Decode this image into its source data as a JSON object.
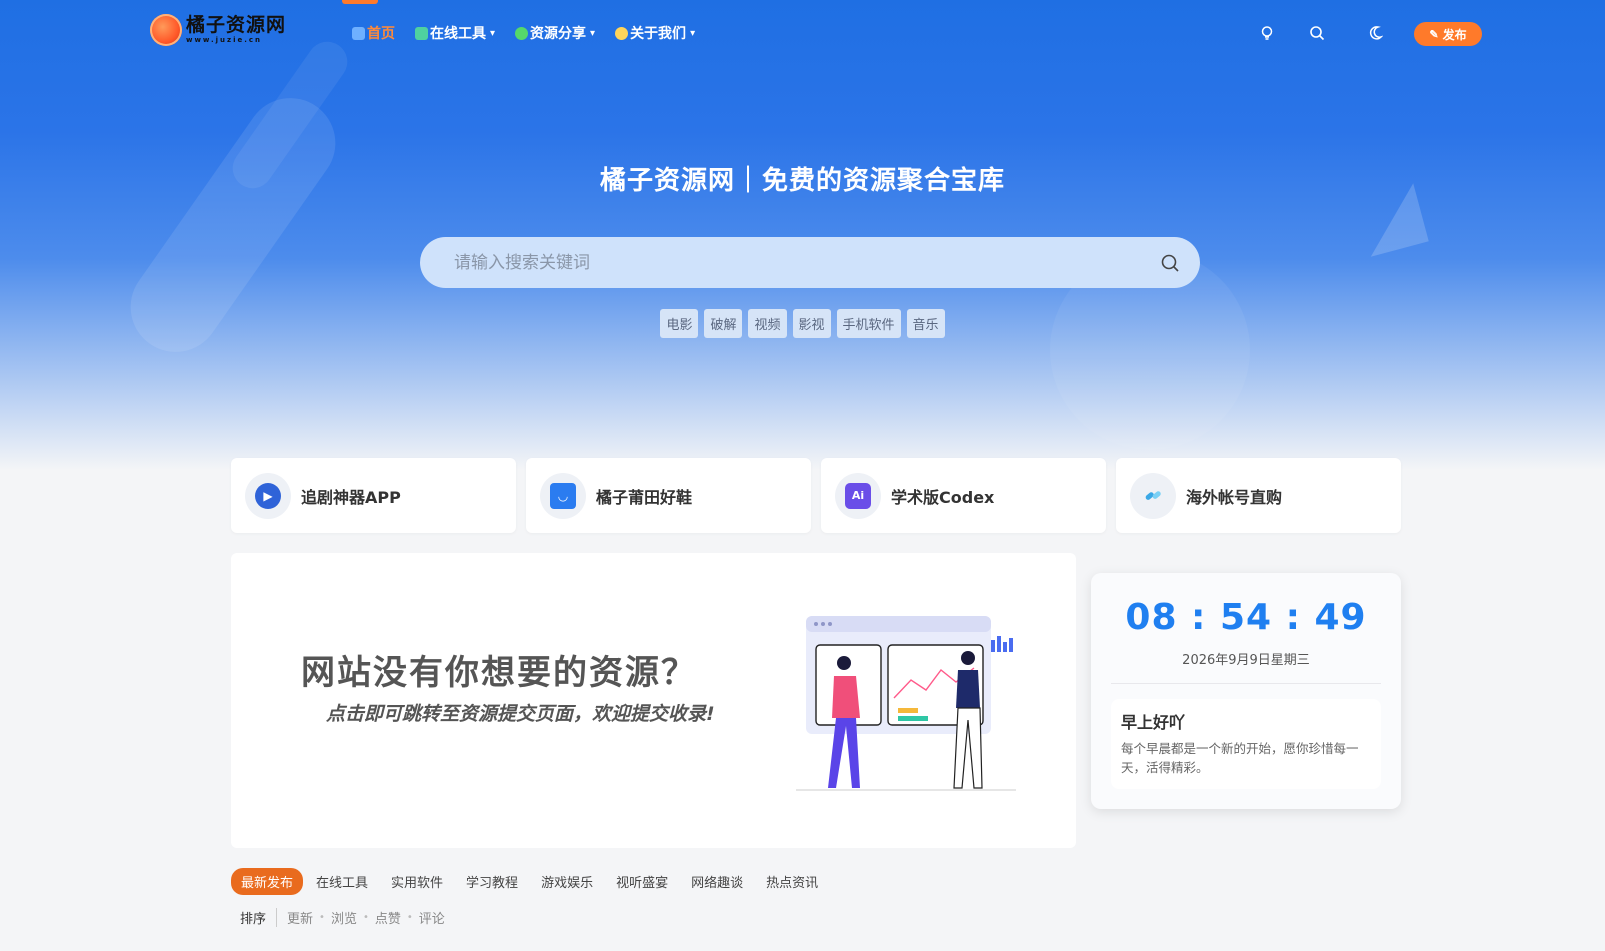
{
  "brand": {
    "name": "橘子资源网",
    "domain": "www.juzie.cn"
  },
  "nav": {
    "items": [
      {
        "label": "首页",
        "active": true
      },
      {
        "label": "在线工具",
        "dropdown": true
      },
      {
        "label": "资源分享",
        "dropdown": true
      },
      {
        "label": "关于我们",
        "dropdown": true
      }
    ],
    "icons": [
      "lightbulb-icon",
      "search-icon",
      "moon-icon"
    ],
    "publish_label": "发布"
  },
  "hero": {
    "title": "橘子资源网｜免费的资源聚合宝库",
    "search_placeholder": "请输入搜索关键词",
    "tags": [
      "电影",
      "破解",
      "视频",
      "影视",
      "手机软件",
      "音乐"
    ]
  },
  "cards": [
    {
      "label": "追剧神器APP",
      "icon": "play-icon",
      "color": "#2f63d8"
    },
    {
      "label": "橘子莆田好鞋",
      "icon": "shopping-bag-icon",
      "color": "#2b7cf0"
    },
    {
      "label": "学术版Codex",
      "icon": "ai-icon",
      "color": "#6a4ee8"
    },
    {
      "label": "海外帐号直购",
      "icon": "link-icon",
      "color": "#3aa8e6"
    }
  ],
  "banner": {
    "headline": "网站没有你想要的资源？",
    "subline": "点击即可跳转至资源提交页面，欢迎提交收录!"
  },
  "clock": {
    "time": "08 : 54 : 49",
    "date": "2026年9月9日星期三",
    "greeting_title": "早上好吖",
    "greeting_text": "每个早晨都是一个新的开始，愿你珍惜每一天，活得精彩。"
  },
  "tabs": [
    "最新发布",
    "在线工具",
    "实用软件",
    "学习教程",
    "游戏娱乐",
    "视听盛宴",
    "网络趣谈",
    "热点资讯"
  ],
  "sort": {
    "label": "排序",
    "options": [
      "更新",
      "浏览",
      "点赞",
      "评论"
    ]
  },
  "colors": {
    "accent": "#ff7a2a",
    "primary": "#1f6fe3",
    "clock": "#1f7ff0"
  }
}
